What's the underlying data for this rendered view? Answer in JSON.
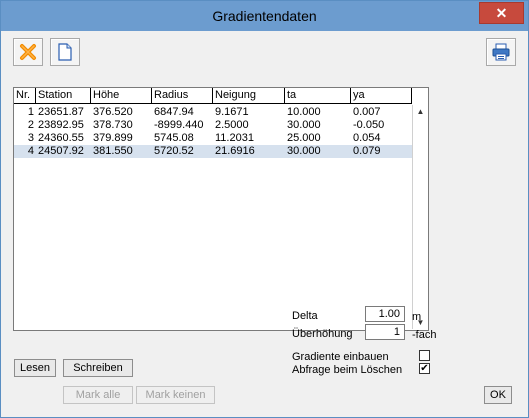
{
  "window": {
    "title": "Gradientendaten",
    "close_glyph": "✕"
  },
  "toolbar": {
    "delete_icon": "delete-x-icon",
    "new_icon": "new-document-icon",
    "print_icon": "printer-icon"
  },
  "table": {
    "columns": [
      "Nr.",
      "Station",
      "Höhe",
      "Radius",
      "Neigung",
      "ta",
      "ya"
    ],
    "rows": [
      [
        "1",
        "23651.87",
        "376.520",
        "6847.94",
        "9.1671",
        "10.000",
        "0.007"
      ],
      [
        "2",
        "23892.95",
        "378.730",
        "-8999.440",
        "2.5000",
        "30.000",
        "-0.050"
      ],
      [
        "3",
        "24360.55",
        "379.899",
        "5745.08",
        "11.2031",
        "25.000",
        "0.054"
      ],
      [
        "4",
        "24507.92",
        "381.550",
        "5720.52",
        "21.6916",
        "30.000",
        "0.079"
      ]
    ],
    "selected_row": 4
  },
  "params": {
    "delta_label": "Delta",
    "delta_value": "1.00",
    "delta_unit": "m",
    "ueber_label": "Überhöhung",
    "ueber_value": "1",
    "ueber_unit": "-fach",
    "einbauen_label": "Gradiente einbauen",
    "einbauen_checked": false,
    "abfrage_label": "Abfrage beim Löschen",
    "abfrage_checked": true
  },
  "buttons": {
    "lesen": "Lesen",
    "schreiben": "Schreiben",
    "mark_alle": "Mark alle",
    "mark_keinen": "Mark keinen",
    "ok": "OK"
  },
  "colors": {
    "titlebar": "#6c9ccf",
    "close": "#c74a3d",
    "selection": "#d6e1ee"
  }
}
